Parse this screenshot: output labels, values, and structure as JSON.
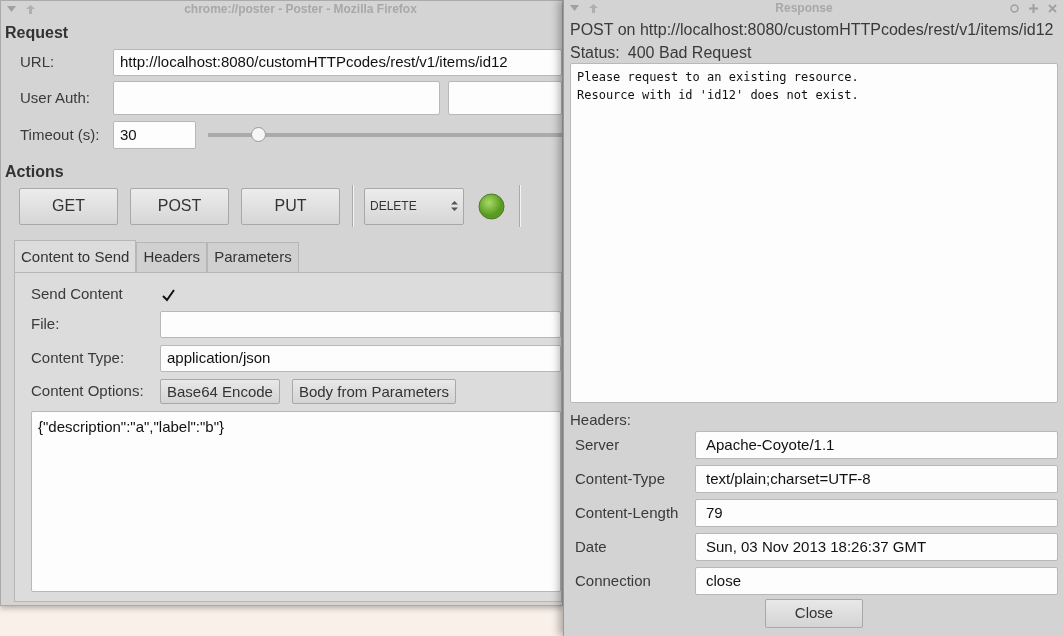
{
  "main_window": {
    "title": "chrome://poster - Poster - Mozilla Firefox"
  },
  "request": {
    "heading": "Request",
    "url_label": "URL:",
    "url": "http://localhost:8080/customHTTPcodes/rest/v1/items/id12",
    "auth_label": "User Auth:",
    "timeout_label": "Timeout (s):",
    "timeout": "30",
    "timeout_slider": {
      "level": 0.14
    }
  },
  "actions": {
    "heading": "Actions",
    "buttons": [
      "GET",
      "POST",
      "PUT"
    ],
    "method_select": "DELETE"
  },
  "tabs": [
    {
      "label": "Content to Send",
      "selected": true
    },
    {
      "label": "Headers",
      "selected": false
    },
    {
      "label": "Parameters",
      "selected": false
    }
  ],
  "content": {
    "send_content_label": "Send Content",
    "send_content_checked": true,
    "file_label": "File:",
    "content_type_label": "Content Type:",
    "content_type": "application/json",
    "options_label": "Content Options:",
    "option_buttons": [
      "Base64 Encode",
      "Body from Parameters"
    ],
    "body": "{\"description\":\"a\",\"label\":\"b\"}"
  },
  "response": {
    "title": "Response",
    "summary": "POST on http://localhost:8080/customHTTPcodes/rest/v1/items/id12",
    "status_label": "Status:",
    "status": "400 Bad Request",
    "body": "Please request to an existing resource.\nResource with id 'id12' does not exist.",
    "headers_label": "Headers:",
    "headers": [
      {
        "name": "Server",
        "value": "Apache-Coyote/1.1"
      },
      {
        "name": "Content-Type",
        "value": "text/plain;charset=UTF-8"
      },
      {
        "name": "Content-Length",
        "value": "79"
      },
      {
        "name": "Date",
        "value": "Sun, 03 Nov 2013 18:26:37 GMT"
      },
      {
        "name": "Connection",
        "value": "close"
      }
    ],
    "close_button": "Close"
  }
}
